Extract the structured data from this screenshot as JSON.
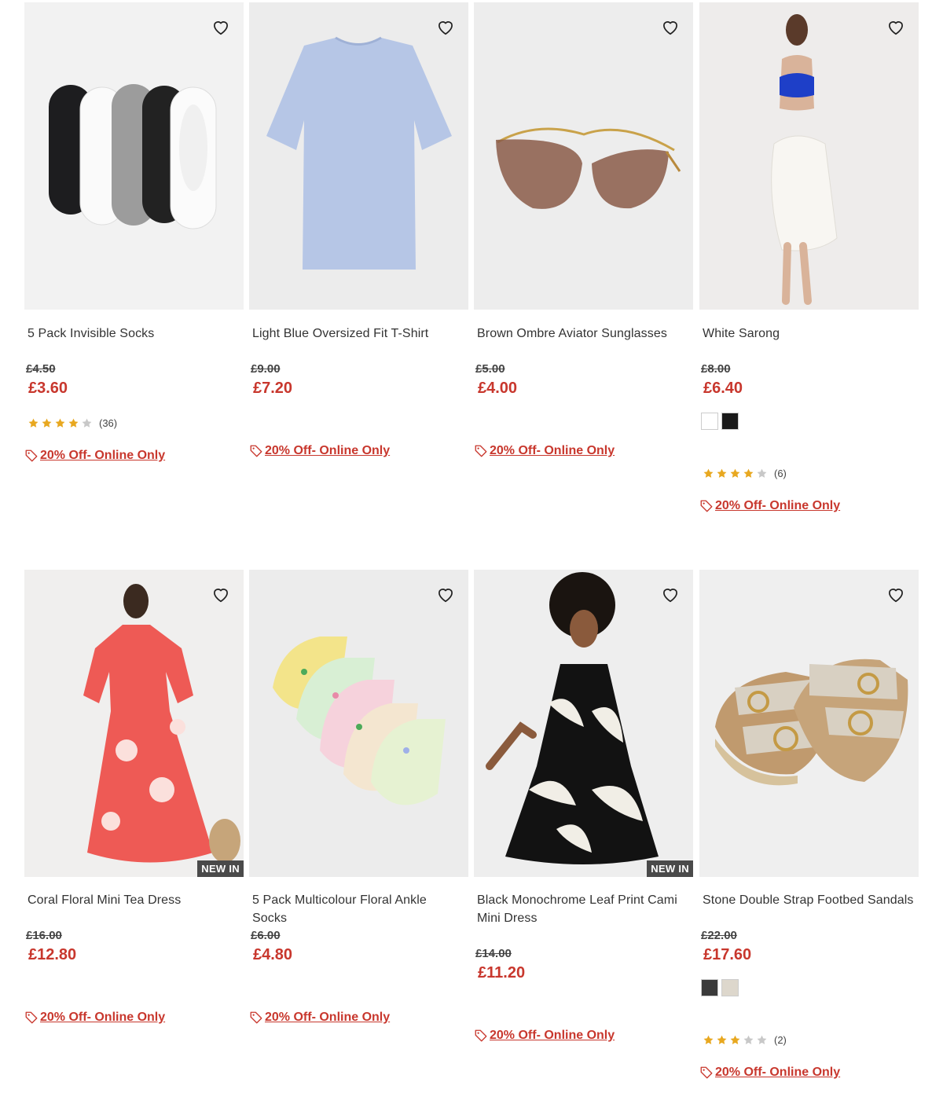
{
  "colors": {
    "sale": "#c8372d",
    "star": "#e8a820",
    "star_empty": "#c8c8c8"
  },
  "products": [
    {
      "name": "5 Pack Invisible Socks",
      "was_price": "£4.50",
      "now_price": "£3.60",
      "rating": 4,
      "rating_count": "(36)",
      "swatches": [],
      "badge": "",
      "promo": "20% Off- Online Only",
      "wishlist_icon": "heart-outline-icon"
    },
    {
      "name": "Light Blue Oversized Fit T-Shirt",
      "was_price": "£9.00",
      "now_price": "£7.20",
      "rating": null,
      "rating_count": "",
      "swatches": [],
      "badge": "",
      "promo": "20% Off- Online Only",
      "wishlist_icon": "heart-outline-icon"
    },
    {
      "name": "Brown Ombre Aviator Sunglasses",
      "was_price": "£5.00",
      "now_price": "£4.00",
      "rating": null,
      "rating_count": "",
      "swatches": [],
      "badge": "",
      "promo": "20% Off- Online Only",
      "wishlist_icon": "heart-outline-icon"
    },
    {
      "name": "White Sarong",
      "was_price": "£8.00",
      "now_price": "£6.40",
      "rating": 4,
      "rating_count": "(6)",
      "swatches": [
        "#ffffff",
        "#1a1a1a"
      ],
      "badge": "",
      "promo": "20% Off- Online Only",
      "wishlist_icon": "heart-outline-icon"
    },
    {
      "name": "Coral Floral Mini Tea Dress",
      "was_price": "£16.00",
      "now_price": "£12.80",
      "rating": null,
      "rating_count": "",
      "swatches": [],
      "badge": "NEW IN",
      "promo": "20% Off- Online Only",
      "wishlist_icon": "heart-outline-icon"
    },
    {
      "name": "5 Pack Multicolour Floral Ankle Socks",
      "was_price": "£6.00",
      "now_price": "£4.80",
      "rating": null,
      "rating_count": "",
      "swatches": [],
      "badge": "",
      "promo": "20% Off- Online Only",
      "wishlist_icon": "heart-outline-icon"
    },
    {
      "name": "Black Monochrome Leaf Print Cami Mini Dress",
      "was_price": "£14.00",
      "now_price": "£11.20",
      "rating": null,
      "rating_count": "",
      "swatches": [],
      "badge": "NEW IN",
      "promo": "20% Off- Online Only",
      "wishlist_icon": "heart-outline-icon"
    },
    {
      "name": "Stone Double Strap Footbed Sandals",
      "was_price": "£22.00",
      "now_price": "£17.60",
      "rating": 3,
      "rating_count": "(2)",
      "swatches": [
        "#3a3a3a",
        "#ddd7cc"
      ],
      "badge": "",
      "promo": "20% Off- Online Only",
      "wishlist_icon": "heart-outline-icon"
    }
  ]
}
